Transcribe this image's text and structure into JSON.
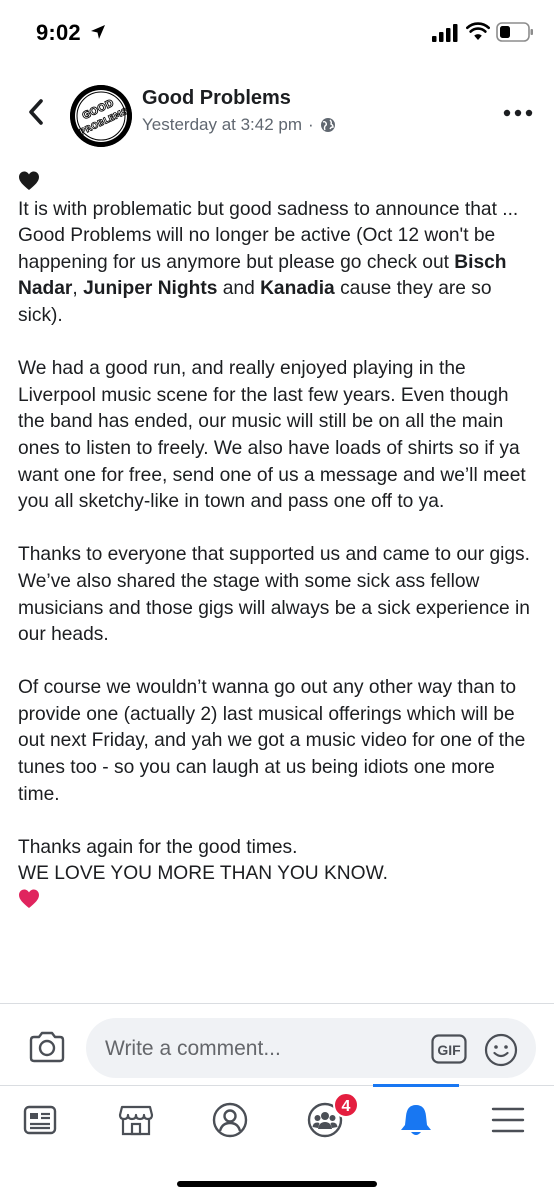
{
  "status_bar": {
    "time": "9:02"
  },
  "post": {
    "page_name": "Good Problems",
    "timestamp": "Yesterday at 3:42 pm",
    "separator": "·",
    "avatar_text": "GOOD PROBLEMS",
    "body": {
      "p1_line1": "It is with problematic but good sadness to announce that ...",
      "p1_line2_a": "Good Problems will no longer be active (Oct 12 won't be happening for us anymore but please go check out ",
      "band1": "Bisch Nadar",
      "sep1": ", ",
      "band2": "Juniper Nights",
      "sep2": " and ",
      "band3": "Kanadia",
      "p1_line2_b": " cause they are so sick).",
      "p2": "We had a good run, and really enjoyed playing in the Liverpool music scene for the last few years.   Even though the band has ended, our music will still be on all the main ones to listen to freely.  We also have loads of shirts so if ya want one for free, send one of us a message and we’ll meet you all sketchy-like in town and pass one off to ya.",
      "p3": "Thanks to everyone that supported us and came to our gigs.  We’ve also shared the stage with some sick ass fellow musicians and those gigs will always be a sick experience in our heads.",
      "p4": "Of course we wouldn’t wanna go out any other way than to provide one (actually 2)  last musical offerings which will be out next Friday, and yah we got a music video for one of the tunes too - so you can laugh at us being idiots one more time.",
      "p5_line1": "Thanks again for the good times.",
      "p5_line2": "WE LOVE YOU MORE THAN YOU KNOW."
    }
  },
  "comment_bar": {
    "placeholder": "Write a comment...",
    "gif_label": "GIF"
  },
  "bottom_nav": {
    "items": [
      "news-feed",
      "marketplace",
      "profile",
      "groups",
      "notifications",
      "menu"
    ],
    "active": "notifications",
    "groups_badge": "4"
  },
  "colors": {
    "accent": "#1877f2",
    "badge": "#e41e3f",
    "text": "#1c1e21",
    "meta": "#606770",
    "input_bg": "#f0f2f5"
  }
}
